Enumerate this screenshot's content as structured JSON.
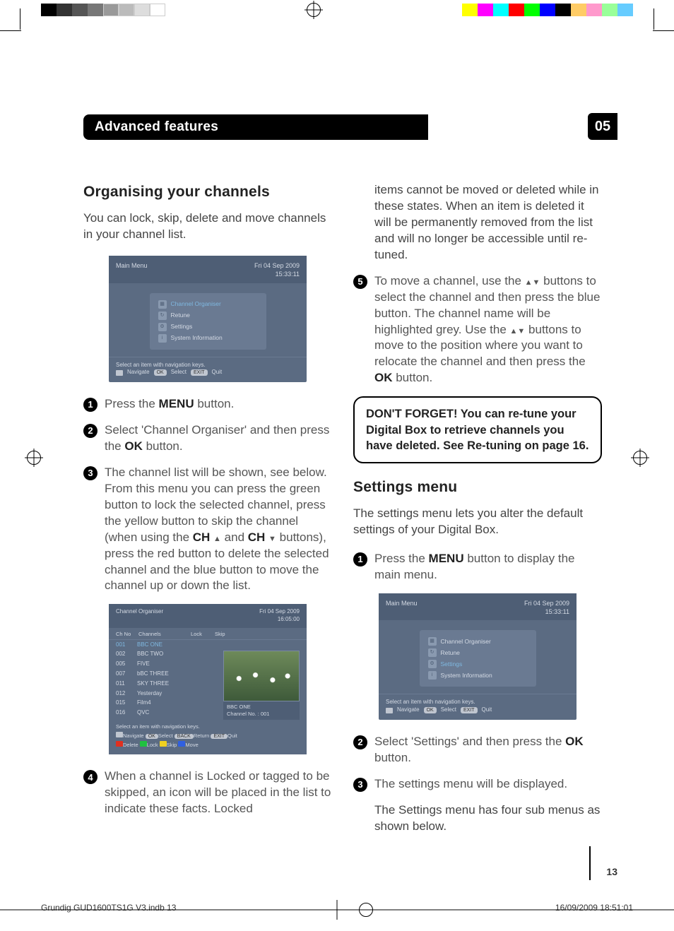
{
  "chapter": {
    "label": "05"
  },
  "header": {
    "title": "Advanced features"
  },
  "sec1": {
    "title": "Organising your channels",
    "intro": "You can lock, skip, delete and move channels in your channel list.",
    "step1_a": "Press the ",
    "step1_menu": "MENU",
    "step1_b": " button.",
    "step2_a": "Select 'Channel Organiser' and then press the ",
    "step2_ok": "OK",
    "step2_b": " button.",
    "step3_a": "The channel list will be shown, see below. From this menu you can press the green button to lock the selected channel, press the yellow button to skip the channel (when using the ",
    "step3_ch1": "CH",
    "step3_mid": " and ",
    "step3_ch2": "CH",
    "step3_b": " buttons), press the red button to delete the selected channel and the blue button to move the channel up or down the list.",
    "step4": "When a  channel is Locked or tagged to be skipped, an icon will be placed in the list to indicate these facts. Locked",
    "step4_cont": "items cannot be moved or deleted while in these states. When an item is deleted it will be permanently removed from the list and will no longer be accessible until re-tuned.",
    "step5_a": "To move a channel, use the ",
    "step5_b": " buttons to select the channel and then press the blue button. The channel name will be highlighted grey. Use the ",
    "step5_c": " buttons to move to the position where you want to relocate the channel and then press the ",
    "step5_ok": "OK",
    "step5_d": " button.",
    "callout": "DON'T FORGET!  You can re-tune your Digital Box to retrieve channels you have deleted. See Re-tuning on page 16."
  },
  "sec2": {
    "title": "Settings menu",
    "intro": "The settings menu lets you alter the default settings of your Digital Box.",
    "step1_a": "Press the ",
    "step1_menu": "MENU",
    "step1_b": " button to display the main menu.",
    "step2_a": "Select 'Settings' and then press the ",
    "step2_ok": "OK",
    "step2_b": " button.",
    "step3": "The settings menu will be displayed.",
    "note": "The Settings menu has four sub menus as shown below."
  },
  "tv1": {
    "title": "Main Menu",
    "date": "Fri   04 Sep 2009",
    "time": "15:33:11",
    "items": [
      "Channel Organiser",
      "Retune",
      "Settings",
      "System Information"
    ],
    "hint": "Select an item with navigation keys.",
    "nav": "Navigate",
    "sel": "Select",
    "quit": "Quit",
    "ok": "OK",
    "exit": "EXIT"
  },
  "tv2": {
    "title": "Channel Organiser",
    "date": "Fri  04 Sep 2009",
    "time": "16:05:00",
    "col1": "Ch No",
    "col2": "Channels",
    "col3": "Lock",
    "col4": "Skip",
    "rows": [
      [
        "001",
        "BBC ONE"
      ],
      [
        "002",
        "BBC TWO"
      ],
      [
        "005",
        "FIVE"
      ],
      [
        "007",
        "bBC THREE"
      ],
      [
        "011",
        "SKY THREE"
      ],
      [
        "012",
        "Yesterday"
      ],
      [
        "015",
        "Film4"
      ],
      [
        "016",
        "QVC"
      ]
    ],
    "pv_name": "BBC ONE",
    "pv_no": "Channel No. : 001",
    "hint": "Select an item with navigation keys.",
    "nav": "Navigate",
    "sel": "Select",
    "ret": "Return",
    "quit": "Quit",
    "del": "Delete",
    "lock": "Lock",
    "skip": "Skip",
    "move": "Move",
    "ok": "OK",
    "back": "BACK",
    "exit": "EXIT"
  },
  "tv3": {
    "title": "Main Menu",
    "date": "Fri   04 Sep 2009",
    "time": "15:33:11",
    "items": [
      "Channel Organiser",
      "Retune",
      "Settings",
      "System Information"
    ],
    "hint": "Select an item with navigation keys.",
    "nav": "Navigate",
    "sel": "Select",
    "quit": "Quit",
    "ok": "OK",
    "exit": "EXIT"
  },
  "page_number": "13",
  "footer": {
    "left": "Grundig GUD1600TS1G V3.indb   13",
    "right": "16/09/2009   18:51:01"
  },
  "colors": {
    "bar_left": [
      "#000",
      "#333",
      "#555",
      "#777",
      "#999",
      "#bbb",
      "#ddd",
      "#fff"
    ],
    "bar_right": [
      "#ffff00",
      "#ff00ff",
      "#00ffff",
      "#ff0000",
      "#00ff00",
      "#0000ff",
      "#000",
      "#ffcc66",
      "#ff99cc",
      "#99ff99",
      "#66ccff"
    ]
  }
}
